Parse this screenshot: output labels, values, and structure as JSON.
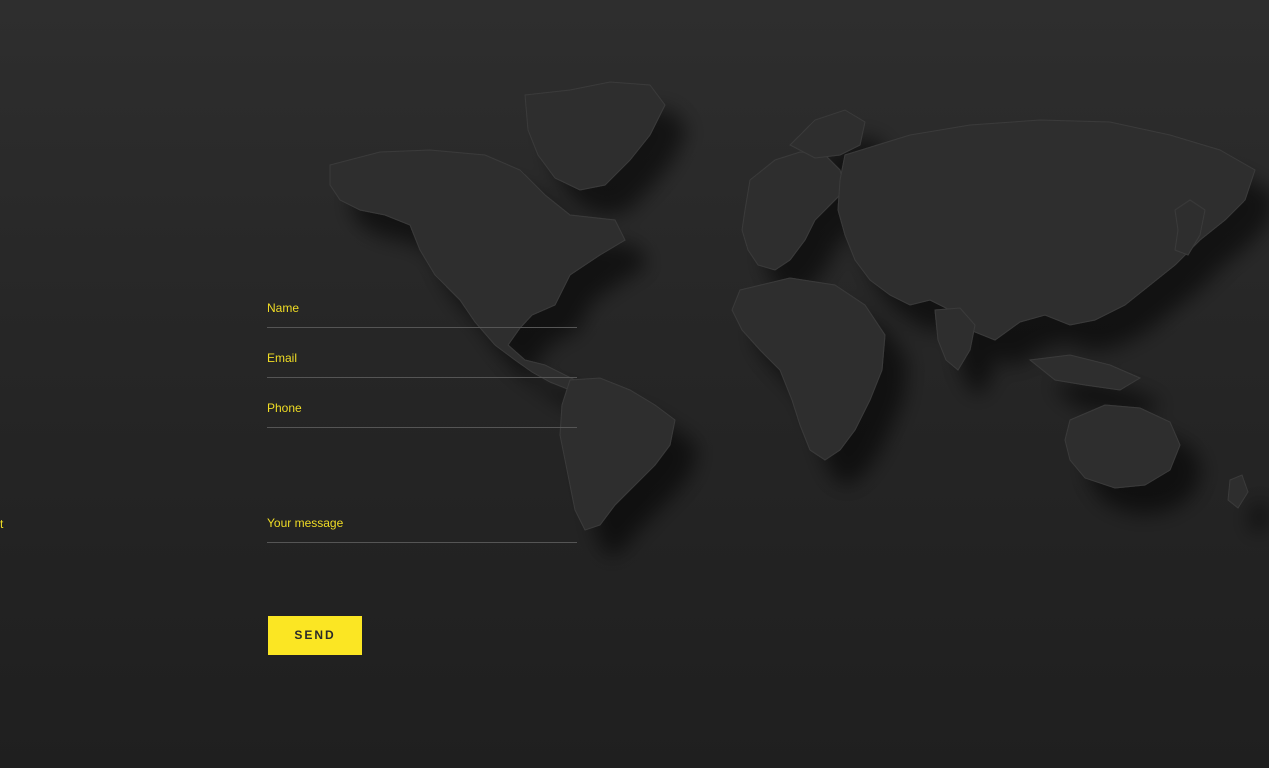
{
  "form": {
    "name_label": "Name",
    "email_label": "Email",
    "phone_label": "Phone",
    "message_label": "Your message",
    "send_label": "SEND"
  },
  "edge_text": "t",
  "colors": {
    "background": "#282828",
    "accent": "#f0dd25",
    "button": "#fbe623",
    "button_text": "#2a2a2a",
    "field_line": "#555555",
    "map_land": "#2f2f2f"
  },
  "map": {
    "icon": "world-map"
  }
}
